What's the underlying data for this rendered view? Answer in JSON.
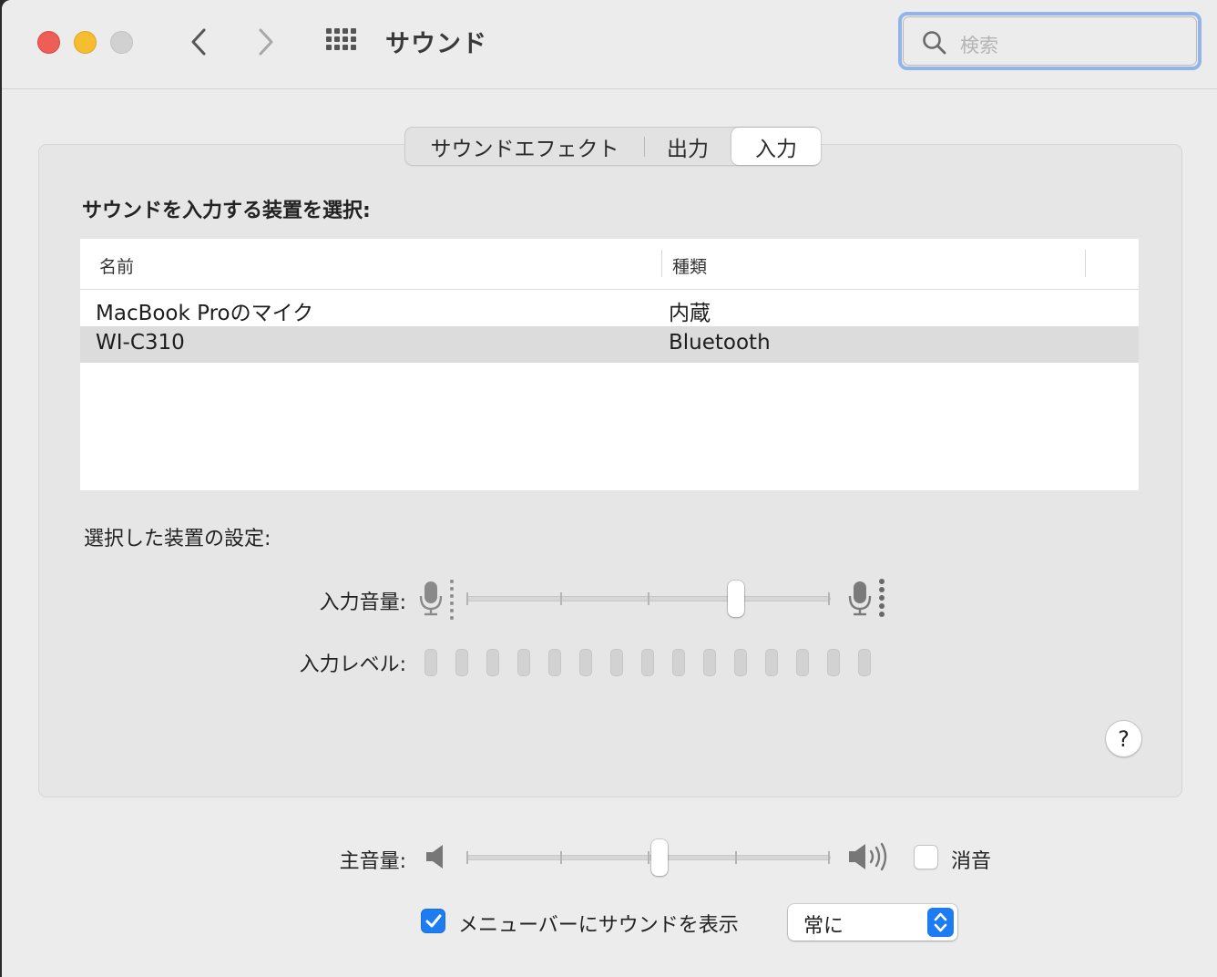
{
  "window": {
    "title": "サウンド",
    "search_placeholder": "検索"
  },
  "tabs": [
    {
      "label": "サウンドエフェクト",
      "selected": false
    },
    {
      "label": "出力",
      "selected": false
    },
    {
      "label": "入力",
      "selected": true
    }
  ],
  "input": {
    "heading": "サウンドを入力する装置を選択:",
    "table": {
      "columns": [
        "名前",
        "種類"
      ],
      "rows": [
        {
          "name": "MacBook Proのマイク",
          "type": "内蔵",
          "selected": false
        },
        {
          "name": "WI-C310",
          "type": "Bluetooth",
          "selected": true
        }
      ]
    },
    "settings_heading": "選択した装置の設定:",
    "volume_label": "入力音量:",
    "volume_level": 0.74,
    "level_label": "入力レベル:",
    "level_segments": 15,
    "level_active": 0
  },
  "footer": {
    "master_volume_label": "主音量:",
    "master_volume_level": 0.53,
    "mute_label": "消音",
    "mute_checked": false,
    "menubar_label": "メニューバーにサウンドを表示",
    "menubar_checked": true,
    "menubar_option": "常に"
  },
  "colors": {
    "accent": "#1d7cf2",
    "close": "#ed5f56",
    "minimize": "#f5bd30",
    "search_focus_ring": "#92b4ea",
    "selected_row": "#dcdcdc"
  },
  "icons": [
    "close-button",
    "minimize-button",
    "zoom-button",
    "chevron-left-icon",
    "chevron-right-icon",
    "grid-icon",
    "search-icon",
    "microphone-icon",
    "speaker-icon",
    "speaker-loud-icon",
    "checkmark-icon",
    "up-down-chevron-icon",
    "help-icon"
  ]
}
